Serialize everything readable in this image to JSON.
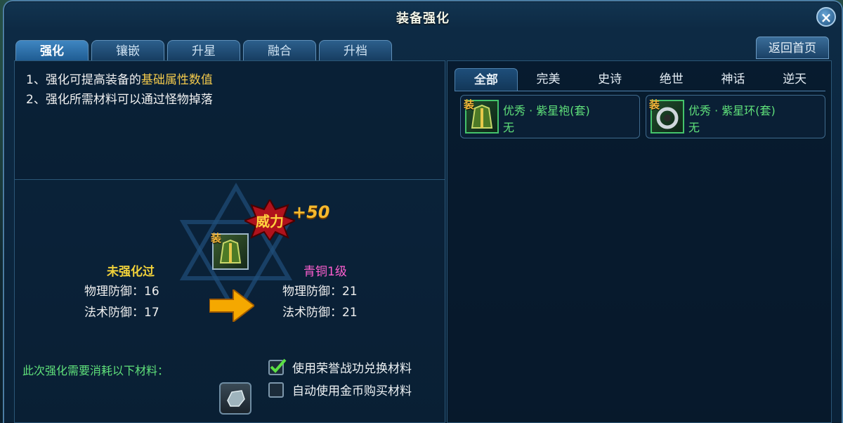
{
  "window": {
    "title": "装备强化",
    "close_symbol": "×"
  },
  "tabs": [
    {
      "label": "强化",
      "active": true
    },
    {
      "label": "镶嵌",
      "active": false
    },
    {
      "label": "升星",
      "active": false
    },
    {
      "label": "融合",
      "active": false
    },
    {
      "label": "升档",
      "active": false
    }
  ],
  "home_button": "返回首页",
  "description": {
    "line1_prefix": "1、强化可提高装备的",
    "line1_highlight": "基础属性数值",
    "line2": "2、强化所需材料可以通过怪物掉落"
  },
  "enhance": {
    "before_title": "未强化过",
    "before_physical": "物理防御：16",
    "before_magic": "法术防御：17",
    "after_title": "青铜1级",
    "after_physical": "物理防御：21",
    "after_magic": "法术防御：21",
    "power_label": "威力",
    "power_bonus": "+50",
    "equip_tag": "装"
  },
  "materials": {
    "required_label": "此次强化需要消耗以下材料：",
    "use_honor": {
      "label": "使用荣誉战功兑换材料",
      "checked": true
    },
    "auto_gold": {
      "label": "自动使用金币购买材料",
      "checked": false
    }
  },
  "right_tabs": [
    {
      "label": "全部",
      "active": true
    },
    {
      "label": "完美",
      "active": false
    },
    {
      "label": "史诗",
      "active": false
    },
    {
      "label": "绝世",
      "active": false
    },
    {
      "label": "神话",
      "active": false
    },
    {
      "label": "逆天",
      "active": false
    }
  ],
  "items": [
    {
      "name": "优秀 · 紫星袍(套)",
      "sub": "无",
      "tag": "装"
    },
    {
      "name": "优秀 · 紫星环(套)",
      "sub": "无",
      "tag": "装"
    }
  ],
  "colors": {
    "rare_green": "#5fe07a",
    "highlight_yellow": "#f2c94c",
    "bronze_pink": "#ff5fd0",
    "bonus_orange": "#f6b92d"
  }
}
